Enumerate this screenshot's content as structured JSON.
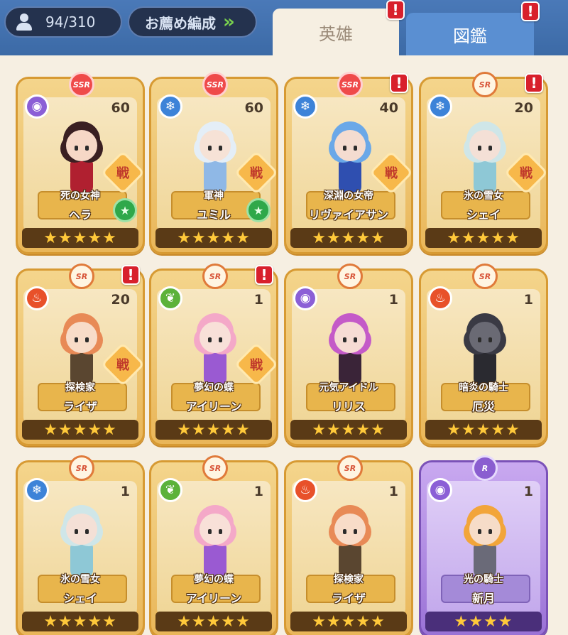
{
  "header": {
    "hero_count": "94/310",
    "recommend_label": "お薦め編成",
    "recommend_chevron": "»",
    "tabs": [
      {
        "label": "英雄",
        "active": true,
        "alert": "!"
      },
      {
        "label": "図鑑",
        "active": false,
        "alert": "!"
      }
    ]
  },
  "battle_badge": "戦",
  "heroes": [
    {
      "rarity": "SSR",
      "element": "dark",
      "level": "60",
      "title": "死の女神",
      "name": "ヘラ",
      "stars": "★★★★★",
      "battle": true,
      "favorite": true,
      "alert": false,
      "palette": {
        "hair": "#3a1f22",
        "skin": "#f6d7c6",
        "outfit": "#b02030"
      }
    },
    {
      "rarity": "SSR",
      "element": "water",
      "level": "60",
      "title": "軍神",
      "name": "ユミル",
      "stars": "★★★★★",
      "battle": true,
      "favorite": true,
      "alert": false,
      "palette": {
        "hair": "#e4eef7",
        "skin": "#f6e2d6",
        "outfit": "#8fb8e6"
      }
    },
    {
      "rarity": "SSR",
      "element": "water",
      "level": "40",
      "title": "深淵の女帝",
      "name": "リヴァイアサン",
      "stars": "★★★★★",
      "battle": true,
      "favorite": false,
      "alert": true,
      "palette": {
        "hair": "#6aa8e8",
        "skin": "#f4dcd0",
        "outfit": "#2f4fb0"
      }
    },
    {
      "rarity": "SR",
      "element": "water",
      "level": "20",
      "title": "氷の雪女",
      "name": "シェイ",
      "stars": "★★★★★",
      "battle": true,
      "favorite": false,
      "alert": true,
      "palette": {
        "hair": "#cfe6e8",
        "skin": "#f4e0d6",
        "outfit": "#8ec8d6"
      }
    },
    {
      "rarity": "SR",
      "element": "fire",
      "level": "20",
      "title": "探検家",
      "name": "ライザ",
      "stars": "★★★★★",
      "battle": true,
      "favorite": false,
      "alert": true,
      "palette": {
        "hair": "#e88a56",
        "skin": "#f8dcc8",
        "outfit": "#5a4630"
      }
    },
    {
      "rarity": "SR",
      "element": "wind",
      "level": "1",
      "title": "夢幻の蝶",
      "name": "アイリーン",
      "stars": "★★★★★",
      "battle": true,
      "favorite": false,
      "alert": true,
      "palette": {
        "hair": "#f4a8c8",
        "skin": "#f8e0d8",
        "outfit": "#9a5ad2"
      }
    },
    {
      "rarity": "SR",
      "element": "dark",
      "level": "1",
      "title": "元気アイドル",
      "name": "リリス",
      "stars": "★★★★★",
      "battle": false,
      "favorite": false,
      "alert": false,
      "palette": {
        "hair": "#c45ac8",
        "skin": "#f6dcd4",
        "outfit": "#3a2438"
      }
    },
    {
      "rarity": "SR",
      "element": "fire",
      "level": "1",
      "title": "暗炎の騎士",
      "name": "厄災",
      "stars": "★★★★★",
      "battle": false,
      "favorite": false,
      "alert": false,
      "palette": {
        "hair": "#3a3a44",
        "skin": "#6a6a74",
        "outfit": "#2a2a30"
      }
    },
    {
      "rarity": "SR",
      "element": "water",
      "level": "1",
      "title": "氷の雪女",
      "name": "シェイ",
      "stars": "★★★★★",
      "battle": false,
      "favorite": false,
      "alert": false,
      "palette": {
        "hair": "#cfe6e8",
        "skin": "#f4e0d6",
        "outfit": "#8ec8d6"
      }
    },
    {
      "rarity": "SR",
      "element": "wind",
      "level": "1",
      "title": "夢幻の蝶",
      "name": "アイリーン",
      "stars": "★★★★★",
      "battle": false,
      "favorite": false,
      "alert": false,
      "palette": {
        "hair": "#f4a8c8",
        "skin": "#f8e0d8",
        "outfit": "#9a5ad2"
      }
    },
    {
      "rarity": "SR",
      "element": "fire",
      "level": "1",
      "title": "探検家",
      "name": "ライザ",
      "stars": "★★★★★",
      "battle": false,
      "favorite": false,
      "alert": false,
      "palette": {
        "hair": "#e88a56",
        "skin": "#f8dcc8",
        "outfit": "#5a4630"
      }
    },
    {
      "rarity": "R",
      "element": "dark",
      "level": "1",
      "title": "光の騎士",
      "name": "新月",
      "stars": "★★★★",
      "battle": false,
      "favorite": false,
      "alert": false,
      "palette": {
        "hair": "#f2a53a",
        "skin": "#f6dcc8",
        "outfit": "#6a6a78"
      }
    }
  ]
}
